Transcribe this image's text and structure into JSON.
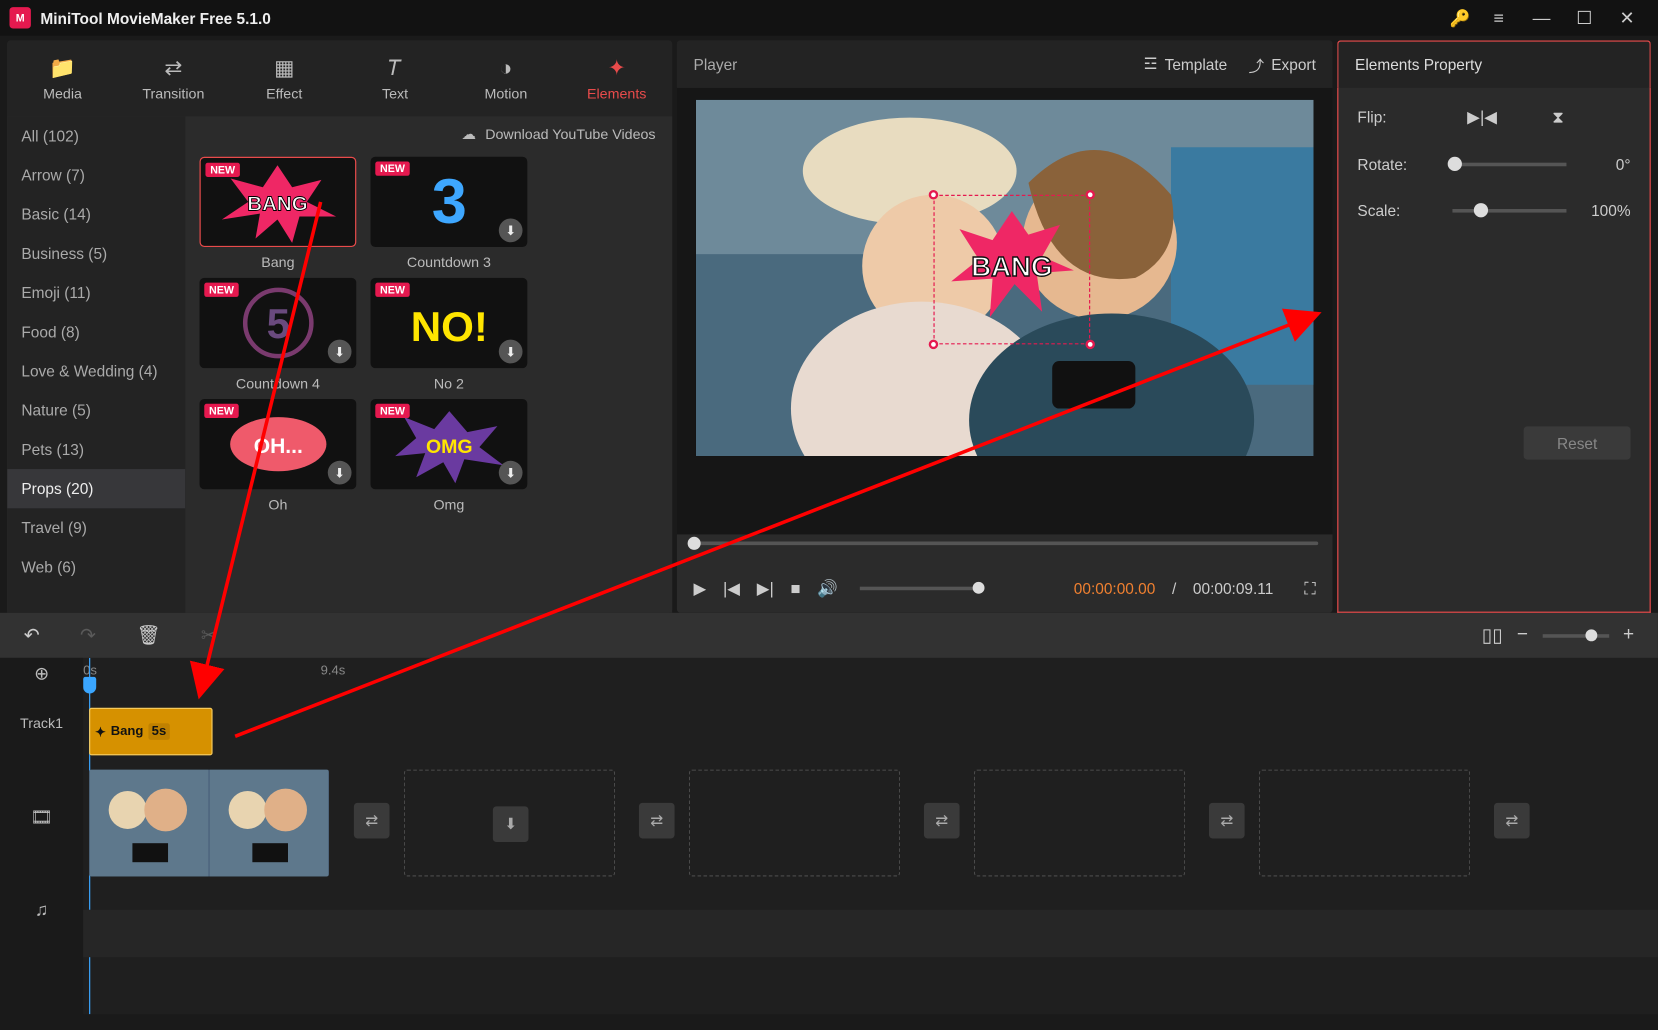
{
  "app": {
    "title": "MiniTool MovieMaker Free 5.1.0"
  },
  "tabs": {
    "media": "Media",
    "transition": "Transition",
    "effect": "Effect",
    "text": "Text",
    "motion": "Motion",
    "elements": "Elements"
  },
  "download_link": "Download YouTube Videos",
  "categories": [
    {
      "label": "All (102)"
    },
    {
      "label": "Arrow (7)"
    },
    {
      "label": "Basic (14)"
    },
    {
      "label": "Business (5)"
    },
    {
      "label": "Emoji (11)"
    },
    {
      "label": "Food (8)"
    },
    {
      "label": "Love & Wedding (4)"
    },
    {
      "label": "Nature (5)"
    },
    {
      "label": "Pets (13)"
    },
    {
      "label": "Props (20)",
      "active": true
    },
    {
      "label": "Travel (9)"
    },
    {
      "label": "Web (6)"
    }
  ],
  "cards": [
    {
      "name": "Bang",
      "new": true,
      "selected": true,
      "dl": false
    },
    {
      "name": "Countdown 3",
      "new": true,
      "dl": true
    },
    {
      "name": "Countdown 4",
      "new": true,
      "dl": true
    },
    {
      "name": "No 2",
      "new": true,
      "dl": true
    },
    {
      "name": "Oh",
      "new": true,
      "dl": true
    },
    {
      "name": "Omg",
      "new": true,
      "dl": true
    }
  ],
  "player": {
    "title": "Player",
    "template": "Template",
    "export": "Export",
    "current": "00:00:00.00",
    "sep": " / ",
    "duration": "00:00:09.11"
  },
  "property": {
    "title": "Elements Property",
    "flip_label": "Flip:",
    "rotate_label": "Rotate:",
    "rotate_value": "0°",
    "scale_label": "Scale:",
    "scale_value": "100%",
    "reset": "Reset"
  },
  "timeline": {
    "ruler0": "0s",
    "ruler1": "9.4s",
    "track1_label": "Track1",
    "clip_name": "Bang",
    "clip_dur": "5s"
  }
}
